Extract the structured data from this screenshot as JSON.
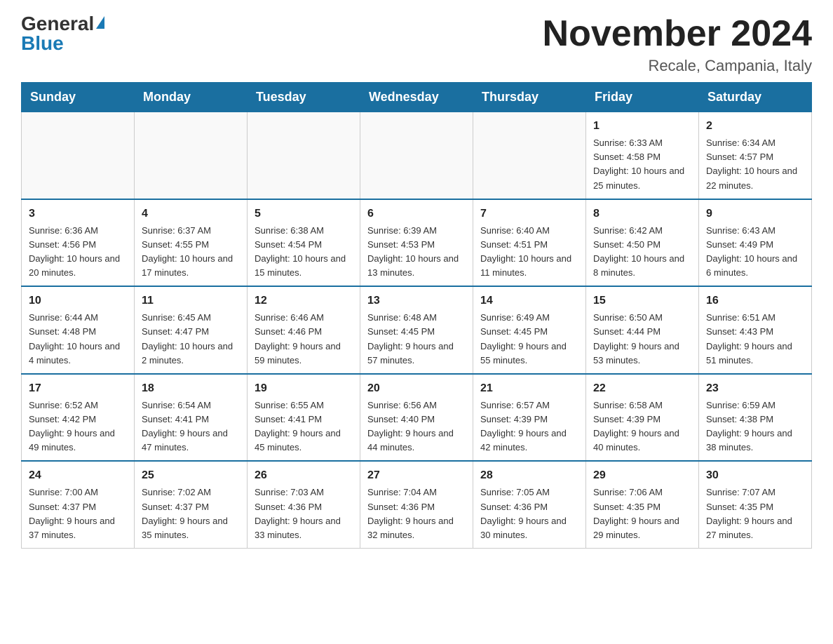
{
  "header": {
    "logo_general": "General",
    "logo_blue": "Blue",
    "month_title": "November 2024",
    "location": "Recale, Campania, Italy"
  },
  "weekdays": [
    "Sunday",
    "Monday",
    "Tuesday",
    "Wednesday",
    "Thursday",
    "Friday",
    "Saturday"
  ],
  "weeks": [
    [
      {
        "day": "",
        "info": ""
      },
      {
        "day": "",
        "info": ""
      },
      {
        "day": "",
        "info": ""
      },
      {
        "day": "",
        "info": ""
      },
      {
        "day": "",
        "info": ""
      },
      {
        "day": "1",
        "info": "Sunrise: 6:33 AM\nSunset: 4:58 PM\nDaylight: 10 hours and 25 minutes."
      },
      {
        "day": "2",
        "info": "Sunrise: 6:34 AM\nSunset: 4:57 PM\nDaylight: 10 hours and 22 minutes."
      }
    ],
    [
      {
        "day": "3",
        "info": "Sunrise: 6:36 AM\nSunset: 4:56 PM\nDaylight: 10 hours and 20 minutes."
      },
      {
        "day": "4",
        "info": "Sunrise: 6:37 AM\nSunset: 4:55 PM\nDaylight: 10 hours and 17 minutes."
      },
      {
        "day": "5",
        "info": "Sunrise: 6:38 AM\nSunset: 4:54 PM\nDaylight: 10 hours and 15 minutes."
      },
      {
        "day": "6",
        "info": "Sunrise: 6:39 AM\nSunset: 4:53 PM\nDaylight: 10 hours and 13 minutes."
      },
      {
        "day": "7",
        "info": "Sunrise: 6:40 AM\nSunset: 4:51 PM\nDaylight: 10 hours and 11 minutes."
      },
      {
        "day": "8",
        "info": "Sunrise: 6:42 AM\nSunset: 4:50 PM\nDaylight: 10 hours and 8 minutes."
      },
      {
        "day": "9",
        "info": "Sunrise: 6:43 AM\nSunset: 4:49 PM\nDaylight: 10 hours and 6 minutes."
      }
    ],
    [
      {
        "day": "10",
        "info": "Sunrise: 6:44 AM\nSunset: 4:48 PM\nDaylight: 10 hours and 4 minutes."
      },
      {
        "day": "11",
        "info": "Sunrise: 6:45 AM\nSunset: 4:47 PM\nDaylight: 10 hours and 2 minutes."
      },
      {
        "day": "12",
        "info": "Sunrise: 6:46 AM\nSunset: 4:46 PM\nDaylight: 9 hours and 59 minutes."
      },
      {
        "day": "13",
        "info": "Sunrise: 6:48 AM\nSunset: 4:45 PM\nDaylight: 9 hours and 57 minutes."
      },
      {
        "day": "14",
        "info": "Sunrise: 6:49 AM\nSunset: 4:45 PM\nDaylight: 9 hours and 55 minutes."
      },
      {
        "day": "15",
        "info": "Sunrise: 6:50 AM\nSunset: 4:44 PM\nDaylight: 9 hours and 53 minutes."
      },
      {
        "day": "16",
        "info": "Sunrise: 6:51 AM\nSunset: 4:43 PM\nDaylight: 9 hours and 51 minutes."
      }
    ],
    [
      {
        "day": "17",
        "info": "Sunrise: 6:52 AM\nSunset: 4:42 PM\nDaylight: 9 hours and 49 minutes."
      },
      {
        "day": "18",
        "info": "Sunrise: 6:54 AM\nSunset: 4:41 PM\nDaylight: 9 hours and 47 minutes."
      },
      {
        "day": "19",
        "info": "Sunrise: 6:55 AM\nSunset: 4:41 PM\nDaylight: 9 hours and 45 minutes."
      },
      {
        "day": "20",
        "info": "Sunrise: 6:56 AM\nSunset: 4:40 PM\nDaylight: 9 hours and 44 minutes."
      },
      {
        "day": "21",
        "info": "Sunrise: 6:57 AM\nSunset: 4:39 PM\nDaylight: 9 hours and 42 minutes."
      },
      {
        "day": "22",
        "info": "Sunrise: 6:58 AM\nSunset: 4:39 PM\nDaylight: 9 hours and 40 minutes."
      },
      {
        "day": "23",
        "info": "Sunrise: 6:59 AM\nSunset: 4:38 PM\nDaylight: 9 hours and 38 minutes."
      }
    ],
    [
      {
        "day": "24",
        "info": "Sunrise: 7:00 AM\nSunset: 4:37 PM\nDaylight: 9 hours and 37 minutes."
      },
      {
        "day": "25",
        "info": "Sunrise: 7:02 AM\nSunset: 4:37 PM\nDaylight: 9 hours and 35 minutes."
      },
      {
        "day": "26",
        "info": "Sunrise: 7:03 AM\nSunset: 4:36 PM\nDaylight: 9 hours and 33 minutes."
      },
      {
        "day": "27",
        "info": "Sunrise: 7:04 AM\nSunset: 4:36 PM\nDaylight: 9 hours and 32 minutes."
      },
      {
        "day": "28",
        "info": "Sunrise: 7:05 AM\nSunset: 4:36 PM\nDaylight: 9 hours and 30 minutes."
      },
      {
        "day": "29",
        "info": "Sunrise: 7:06 AM\nSunset: 4:35 PM\nDaylight: 9 hours and 29 minutes."
      },
      {
        "day": "30",
        "info": "Sunrise: 7:07 AM\nSunset: 4:35 PM\nDaylight: 9 hours and 27 minutes."
      }
    ]
  ]
}
